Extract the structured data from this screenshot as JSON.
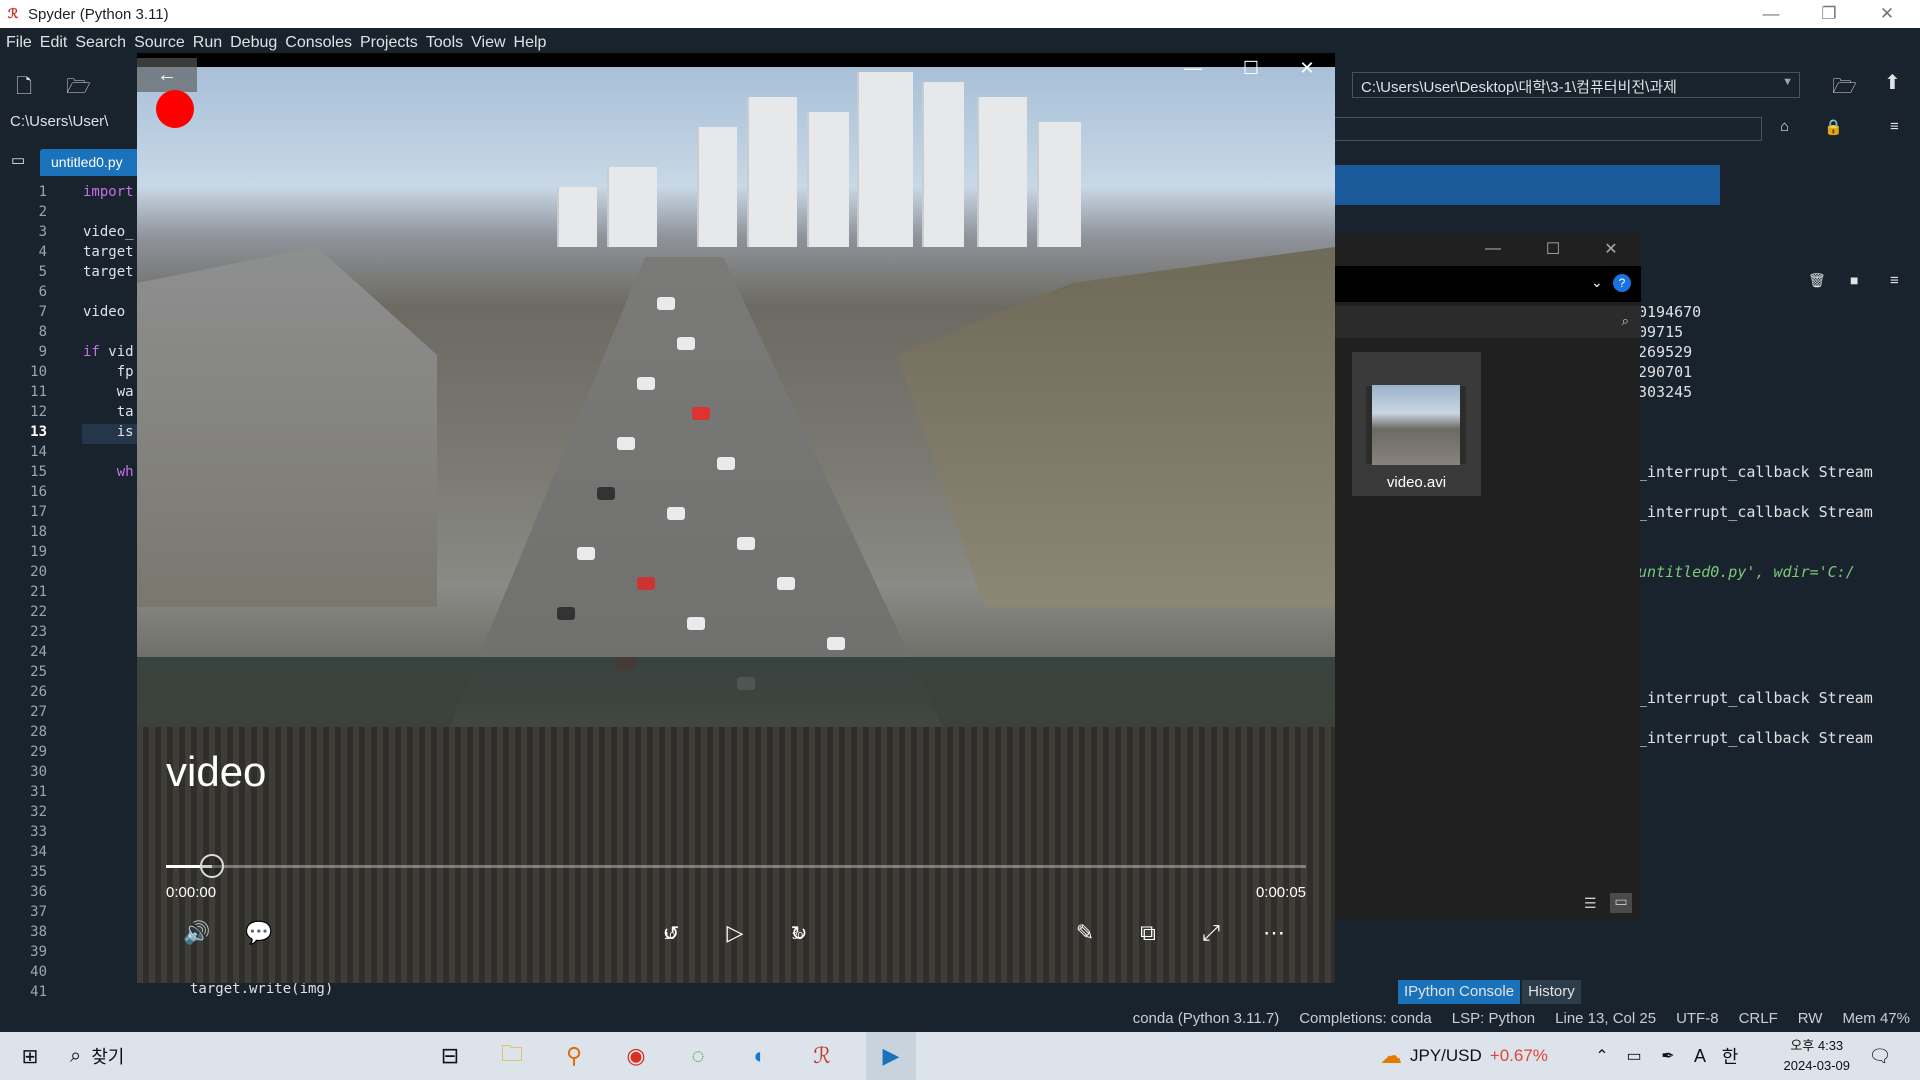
{
  "window": {
    "title": "Spyder (Python 3.11)",
    "minimize": "—",
    "restore": "❐",
    "close": "✕"
  },
  "menu": [
    "File",
    "Edit",
    "Search",
    "Source",
    "Run",
    "Debug",
    "Consoles",
    "Projects",
    "Tools",
    "View",
    "Help"
  ],
  "toolbar": {
    "path": "C:\\Users\\User\\Desktop\\대학\\3-1\\컴퓨터비전\\과제"
  },
  "editor": {
    "file_path": "C:\\Users\\User\\",
    "tab": "untitled0.py",
    "current_line": 13,
    "line_numbers": [
      "1",
      "2",
      "3",
      "4",
      "5",
      "6",
      "7",
      "8",
      "9",
      "10",
      "11",
      "12",
      "13",
      "14",
      "15",
      "16",
      "17",
      "18",
      "19",
      "20",
      "21",
      "22",
      "23",
      "24",
      "25",
      "26",
      "27",
      "28",
      "29",
      "30",
      "31",
      "32",
      "33",
      "34",
      "35",
      "36",
      "37",
      "38",
      "39",
      "40",
      "41"
    ],
    "visible_code": [
      {
        "n": 1,
        "text": "import"
      },
      {
        "n": 3,
        "text": "video_"
      },
      {
        "n": 4,
        "text": "target"
      },
      {
        "n": 5,
        "text": "target"
      },
      {
        "n": 7,
        "text": "video "
      },
      {
        "n": 9,
        "text": "if vid"
      },
      {
        "n": 10,
        "text": "    fp"
      },
      {
        "n": 11,
        "text": "    wa"
      },
      {
        "n": 12,
        "text": "    ta"
      },
      {
        "n": 13,
        "text": "    is"
      },
      {
        "n": 15,
        "text": "    wh"
      }
    ],
    "bottom_line": "target.write(img)"
  },
  "console": {
    "lines": [
      "0194670",
      "09715",
      "269529",
      "290701",
      "303245",
      "_interrupt_callback Stream",
      "_interrupt_callback Stream",
      "untitled0.py', wdir='C:/",
      "_interrupt_callback Stream",
      "_interrupt_callback Stream"
    ],
    "tabs": [
      "IPython Console",
      "History"
    ]
  },
  "explorer": {
    "file_name": "video.avi"
  },
  "player": {
    "video_title": "video",
    "current_time": "0:00:00",
    "end_time": "0:00:05",
    "progress": 0.04,
    "skip_back": "10",
    "skip_forward": "30"
  },
  "status": {
    "env": "conda (Python 3.11.7)",
    "completions": "Completions: conda",
    "lsp": "LSP: Python",
    "position": "Line 13, Col 25",
    "encoding": "UTF-8",
    "eol": "CRLF",
    "rw": "RW",
    "mem": "Mem 47%"
  },
  "taskbar": {
    "search_label": "찾기",
    "stock_label": "JPY/USD",
    "stock_change": "+0.67%",
    "ime_a": "A",
    "ime_han": "한",
    "time": "오후 4:33",
    "date": "2024-03-09"
  },
  "colors": {
    "accent": "#1a72bb",
    "stock_change": "#e0453a",
    "record": "#ff0000"
  }
}
